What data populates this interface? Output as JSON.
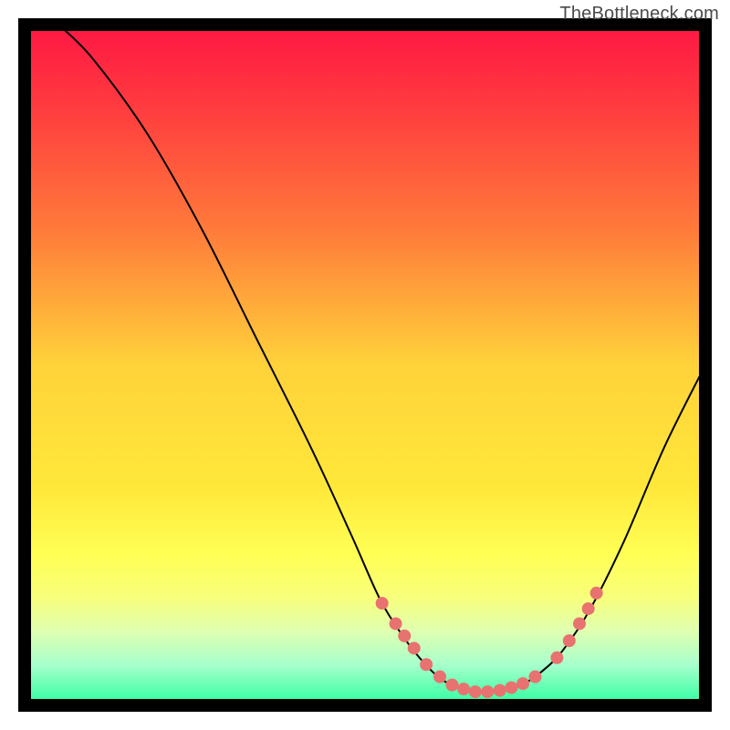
{
  "watermark": "TheBottleneck.com",
  "chart_data": {
    "type": "line",
    "title": "",
    "xlabel": "",
    "ylabel": "",
    "xlim": [
      0,
      100
    ],
    "ylim": [
      0,
      100
    ],
    "gradient_stops": [
      {
        "offset": 0.0,
        "color": "#ff1744"
      },
      {
        "offset": 0.12,
        "color": "#ff3b3f"
      },
      {
        "offset": 0.3,
        "color": "#ff7a3a"
      },
      {
        "offset": 0.5,
        "color": "#ffd23a"
      },
      {
        "offset": 0.68,
        "color": "#ffe83a"
      },
      {
        "offset": 0.78,
        "color": "#ffff55"
      },
      {
        "offset": 0.84,
        "color": "#f8ff7a"
      },
      {
        "offset": 0.89,
        "color": "#e0ffb0"
      },
      {
        "offset": 0.94,
        "color": "#a8ffcc"
      },
      {
        "offset": 1.0,
        "color": "#2bff9e"
      }
    ],
    "frame": {
      "stroke": "#000000",
      "stroke_width": 14
    },
    "series": [
      {
        "name": "bottleneck-curve",
        "stroke": "#000000",
        "stroke_width": 2,
        "points": [
          {
            "x": 5,
            "y": 100
          },
          {
            "x": 10,
            "y": 95
          },
          {
            "x": 18,
            "y": 84
          },
          {
            "x": 26,
            "y": 70
          },
          {
            "x": 34,
            "y": 54
          },
          {
            "x": 42,
            "y": 38
          },
          {
            "x": 48,
            "y": 25
          },
          {
            "x": 52,
            "y": 16
          },
          {
            "x": 55,
            "y": 11
          },
          {
            "x": 58,
            "y": 7
          },
          {
            "x": 61,
            "y": 4
          },
          {
            "x": 64,
            "y": 2.5
          },
          {
            "x": 67,
            "y": 2
          },
          {
            "x": 70,
            "y": 2.2
          },
          {
            "x": 73,
            "y": 3
          },
          {
            "x": 76,
            "y": 5
          },
          {
            "x": 79,
            "y": 8
          },
          {
            "x": 83,
            "y": 14
          },
          {
            "x": 88,
            "y": 24
          },
          {
            "x": 94,
            "y": 38
          },
          {
            "x": 100,
            "y": 50
          }
        ]
      }
    ],
    "markers": {
      "color": "#e8726f",
      "radius": 7,
      "points": [
        {
          "x": 52.5,
          "y": 15
        },
        {
          "x": 54.5,
          "y": 12
        },
        {
          "x": 55.8,
          "y": 10.2
        },
        {
          "x": 57.2,
          "y": 8.4
        },
        {
          "x": 59.0,
          "y": 6.0
        },
        {
          "x": 61.0,
          "y": 4.2
        },
        {
          "x": 62.8,
          "y": 3.0
        },
        {
          "x": 64.5,
          "y": 2.4
        },
        {
          "x": 66.2,
          "y": 2.0
        },
        {
          "x": 68.0,
          "y": 2.0
        },
        {
          "x": 69.8,
          "y": 2.2
        },
        {
          "x": 71.5,
          "y": 2.6
        },
        {
          "x": 73.2,
          "y": 3.2
        },
        {
          "x": 75.0,
          "y": 4.2
        },
        {
          "x": 78.2,
          "y": 7.0
        },
        {
          "x": 80.0,
          "y": 9.5
        },
        {
          "x": 81.5,
          "y": 12.0
        },
        {
          "x": 82.8,
          "y": 14.2
        },
        {
          "x": 84.0,
          "y": 16.5
        }
      ]
    }
  }
}
